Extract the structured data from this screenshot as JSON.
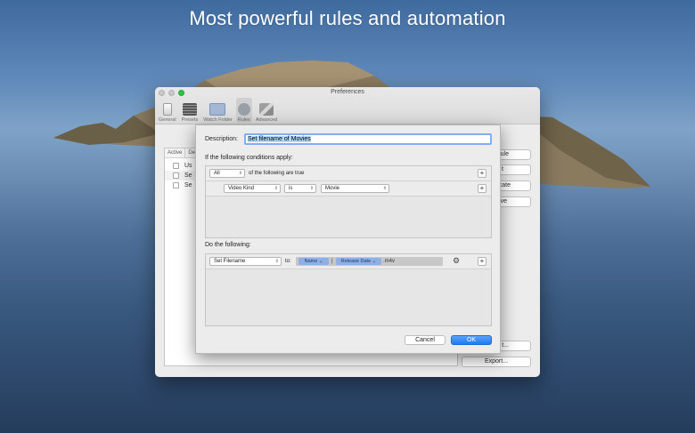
{
  "headline": "Most powerful rules and automation",
  "window": {
    "title": "Preferences",
    "toolbar": [
      {
        "label": "General",
        "icon": "general-icon"
      },
      {
        "label": "Presets",
        "icon": "presets-icon"
      },
      {
        "label": "Watch Folder",
        "icon": "watch-folder-icon"
      },
      {
        "label": "Rules",
        "icon": "rules-icon",
        "active": true
      },
      {
        "label": "Advanced",
        "icon": "advanced-icon"
      }
    ],
    "list": {
      "headers": [
        "Active",
        "De"
      ],
      "rows": [
        "Us",
        "Se",
        "Se"
      ]
    },
    "side_buttons": [
      "ule",
      "t",
      "cate",
      "ve",
      "t...",
      "Export..."
    ]
  },
  "sheet": {
    "description_label": "Description:",
    "description_value": "Set filename of Movies",
    "conditions_label": "If the following conditions apply:",
    "match_popup": "All",
    "match_suffix": "of the following are true",
    "condition": {
      "field": "Video Kind",
      "operator": "is",
      "value": "Movie"
    },
    "actions_label": "Do the following:",
    "action": {
      "type": "Set Filename",
      "to_label": "to:",
      "token_name": "Name",
      "token_sep": "|",
      "token_date": "Release Date",
      "suffix": ".m4v"
    },
    "plus": "+",
    "cancel": "Cancel",
    "ok": "OK"
  }
}
